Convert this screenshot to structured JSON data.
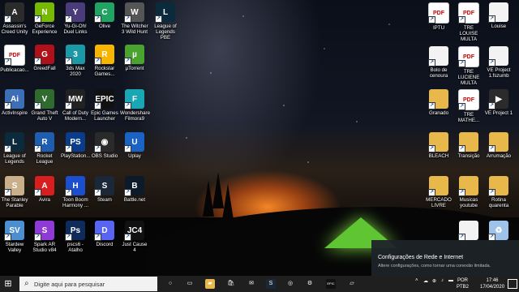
{
  "desktop": {
    "left_icons": [
      {
        "label": "Assassin's Creed Unity",
        "glyph": "A",
        "bg": "#2b2b2b"
      },
      {
        "label": "GeForce Experience",
        "glyph": "N",
        "bg": "#76b900"
      },
      {
        "label": "Yu-Gi-Oh! Duel Links",
        "glyph": "Y",
        "bg": "#4a3c7a"
      },
      {
        "label": "Olive",
        "glyph": "C",
        "bg": "#1fa463"
      },
      {
        "label": "The Witcher 3 Wild Hunt",
        "glyph": "W",
        "bg": "#555"
      },
      {
        "label": "League of Legends PBE",
        "glyph": "L",
        "bg": "#0b2a3c"
      },
      {
        "label": "Publicacao...",
        "glyph": "PDF",
        "bg": "pdf"
      },
      {
        "label": "GreedFall",
        "glyph": "G",
        "bg": "#b0101a"
      },
      {
        "label": "3ds Max 2020",
        "glyph": "3",
        "bg": "#1a9aa6"
      },
      {
        "label": "Rockstar Games...",
        "glyph": "R",
        "bg": "#f7b500"
      },
      {
        "label": "µTorrent",
        "glyph": "µ",
        "bg": "#4aa32e"
      },
      {
        "label": "ActivInspire",
        "glyph": "Ai",
        "bg": "#3d6fb6"
      },
      {
        "label": "Grand Theft Auto V",
        "glyph": "V",
        "bg": "#2f6b2f"
      },
      {
        "label": "Call of Duty Modern...",
        "glyph": "MW",
        "bg": "#222"
      },
      {
        "label": "Epic Games Launcher",
        "glyph": "EPIC",
        "bg": "#111"
      },
      {
        "label": "Wondershare Filmora9",
        "glyph": "F",
        "bg": "#19a7b5"
      },
      {
        "label": "League of Legends",
        "glyph": "L",
        "bg": "#0b2a3c"
      },
      {
        "label": "Rocket League",
        "glyph": "R",
        "bg": "#1d5eb0"
      },
      {
        "label": "PlayStation...",
        "glyph": "PS",
        "bg": "#0a3c8c"
      },
      {
        "label": "OBS Studio",
        "glyph": "◉",
        "bg": "#2a2a2a"
      },
      {
        "label": "Uplay",
        "glyph": "U",
        "bg": "#1b62c5"
      },
      {
        "label": "The Stanley Parable",
        "glyph": "S",
        "bg": "#c9b08a"
      },
      {
        "label": "Avira",
        "glyph": "A",
        "bg": "#d81e1e"
      },
      {
        "label": "Toon Boom Harmony ...",
        "glyph": "H",
        "bg": "#1b4fd0"
      },
      {
        "label": "Steam",
        "glyph": "S",
        "bg": "#1b2838"
      },
      {
        "label": "Battle.net",
        "glyph": "B",
        "bg": "#0d1a2a"
      },
      {
        "label": "Stardew Valley",
        "glyph": "SV",
        "bg": "#4b8fd1"
      },
      {
        "label": "Spark AR Studio v84",
        "glyph": "S",
        "bg": "#8f3ad6"
      },
      {
        "label": "pscs6 - Atalho",
        "glyph": "Ps",
        "bg": "#0f2b5c"
      },
      {
        "label": "Discord",
        "glyph": "D",
        "bg": "#5865f2"
      },
      {
        "label": "Just Cause 4",
        "glyph": "JC4",
        "bg": "#111"
      }
    ],
    "right_icons": [
      {
        "label": "IPTU",
        "glyph": "PDF",
        "bg": "pdf"
      },
      {
        "label": "TRE LOUISE MULTA",
        "glyph": "PDF",
        "bg": "pdf"
      },
      {
        "label": "Louise",
        "glyph": "",
        "bg": "file"
      },
      {
        "label": "Bolo de cenoura",
        "glyph": "",
        "bg": "file"
      },
      {
        "label": "TRE LUCIENE MULTA",
        "glyph": "PDF",
        "bg": "pdf"
      },
      {
        "label": "VE Project 1.fszumb",
        "glyph": "",
        "bg": "file"
      },
      {
        "label": "Granado",
        "glyph": "",
        "bg": "folder"
      },
      {
        "label": "TRE MATHE...",
        "glyph": "PDF",
        "bg": "pdf"
      },
      {
        "label": "VE Project 1",
        "glyph": "▶",
        "bg": "#2b2b2b"
      },
      {
        "label": "BLEACH",
        "glyph": "",
        "bg": "folder"
      },
      {
        "label": "Transição",
        "glyph": "",
        "bg": "folder"
      },
      {
        "label": "Arrumação",
        "glyph": "",
        "bg": "folder"
      },
      {
        "label": "MERCADO LIVRE",
        "glyph": "",
        "bg": "folder"
      },
      {
        "label": "Musicas youtube",
        "glyph": "",
        "bg": "folder"
      },
      {
        "label": "Rotina quarenta",
        "glyph": "",
        "bg": "folder"
      },
      {
        "label": "",
        "glyph": "",
        "bg": "file"
      },
      {
        "label": "",
        "glyph": "♻",
        "bg": "#9fc3e8"
      }
    ]
  },
  "notification": {
    "title": "Configurações de Rede e Internet",
    "subtitle": "Altere configurações, como tornar uma conexão limitada."
  },
  "taskbar": {
    "search_placeholder": "Digite aqui para pesquisar",
    "apps": [
      {
        "name": "cortana-icon",
        "glyph": "○",
        "bg": "transparent"
      },
      {
        "name": "task-view-icon",
        "glyph": "▭",
        "bg": "transparent"
      },
      {
        "name": "file-explorer-icon",
        "glyph": "▰",
        "bg": "#e8b94a"
      },
      {
        "name": "store-icon",
        "glyph": "🛍",
        "bg": "transparent"
      },
      {
        "name": "mail-icon",
        "glyph": "✉",
        "bg": "transparent"
      },
      {
        "name": "steam-taskbar-icon",
        "glyph": "S",
        "bg": "#1b2838"
      },
      {
        "name": "chrome-icon",
        "glyph": "◎",
        "bg": "transparent"
      },
      {
        "name": "settings-icon",
        "glyph": "⚙",
        "bg": "transparent"
      },
      {
        "name": "epic-taskbar-icon",
        "glyph": "EPIC",
        "bg": "#111"
      },
      {
        "name": "explorer-2-icon",
        "glyph": "▱",
        "bg": "transparent"
      }
    ],
    "language_top": "POR",
    "language_bottom": "PTB2",
    "time": "17:46",
    "date": "17/04/2020"
  }
}
